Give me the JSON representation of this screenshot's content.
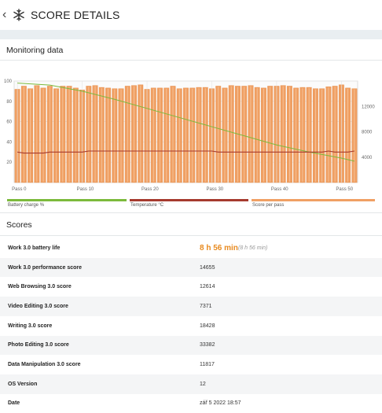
{
  "header": {
    "back_icon": "chevron-left-icon",
    "app_icon": "snowflake-icon",
    "title": "SCORE DETAILS"
  },
  "monitoring": {
    "title": "Monitoring data"
  },
  "chart_data": {
    "type": "bar",
    "x_tick_labels": [
      "Pass 0",
      "Pass 10",
      "Pass 20",
      "Pass 30",
      "Pass 40",
      "Pass 50"
    ],
    "y_left_ticks": [
      "100",
      "80",
      "60",
      "40",
      "20"
    ],
    "y_right_ticks": [
      "12000",
      "8000",
      "4000"
    ],
    "y_left_range": [
      0,
      100
    ],
    "y_right_range": [
      0,
      16000
    ],
    "grid": true,
    "legend_position": "bottom",
    "series": [
      {
        "name": "Battery charge %",
        "color": "#7cba3c",
        "type": "line",
        "axis": "left",
        "x": [
          0,
          5,
          10,
          15,
          20,
          25,
          30,
          35,
          40,
          45,
          50,
          52
        ],
        "values": [
          98,
          96,
          90,
          82,
          73,
          64,
          55,
          46,
          37,
          30,
          24,
          21
        ]
      },
      {
        "name": "Temperature °C",
        "color": "#a63a2e",
        "type": "line",
        "axis": "left",
        "x": [
          0,
          1,
          2,
          3,
          4,
          5,
          6,
          7,
          8,
          9,
          10,
          11,
          12,
          13,
          14,
          15,
          16,
          17,
          18,
          19,
          20,
          21,
          22,
          23,
          24,
          25,
          26,
          27,
          28,
          29,
          30,
          31,
          32,
          33,
          34,
          35,
          36,
          37,
          38,
          39,
          40,
          41,
          42,
          43,
          44,
          45,
          46,
          47,
          48,
          49,
          50,
          51,
          52
        ],
        "values": [
          30,
          29,
          29,
          29,
          29,
          30,
          30,
          30,
          30,
          30,
          30,
          31,
          31,
          31,
          31,
          31,
          31,
          31,
          31,
          31,
          31,
          31,
          31,
          31,
          31,
          31,
          31,
          31,
          31,
          31,
          31,
          30,
          30,
          30,
          30,
          30,
          30,
          30,
          30,
          30,
          30,
          30,
          30,
          30,
          30,
          30,
          30,
          30,
          31,
          30,
          30,
          30,
          31
        ]
      },
      {
        "name": "Score per pass",
        "color": "#f0a064",
        "type": "bar",
        "axis": "right",
        "x": [
          0,
          1,
          2,
          3,
          4,
          5,
          6,
          7,
          8,
          9,
          10,
          11,
          12,
          13,
          14,
          15,
          16,
          17,
          18,
          19,
          20,
          21,
          22,
          23,
          24,
          25,
          26,
          27,
          28,
          29,
          30,
          31,
          32,
          33,
          34,
          35,
          36,
          37,
          38,
          39,
          40,
          41,
          42,
          43,
          44,
          45,
          46,
          47,
          48,
          49,
          50,
          51,
          52
        ],
        "values": [
          14700,
          15200,
          14800,
          15300,
          14900,
          15200,
          14800,
          15200,
          15200,
          14900,
          14600,
          15200,
          15300,
          15000,
          14900,
          14800,
          14800,
          15200,
          15300,
          15400,
          14700,
          14900,
          14900,
          14900,
          15200,
          14800,
          14900,
          14900,
          15000,
          15000,
          14800,
          15200,
          14900,
          15300,
          15200,
          15200,
          15300,
          15000,
          14900,
          15200,
          15200,
          15300,
          15200,
          14900,
          15000,
          15000,
          14800,
          14800,
          15100,
          15200,
          15400,
          14900,
          14800
        ]
      }
    ]
  },
  "scores": {
    "title": "Scores",
    "rows": [
      {
        "label": "Work 3.0 battery life",
        "value": "8 h 56 min",
        "sub": "(8 h 56 min)"
      },
      {
        "label": "Work 3.0 performance score",
        "value": "14655"
      },
      {
        "label": "Web Browsing 3.0 score",
        "value": "12614"
      },
      {
        "label": "Video Editing 3.0 score",
        "value": "7371"
      },
      {
        "label": "Writing 3.0 score",
        "value": "18428"
      },
      {
        "label": "Photo Editing 3.0 score",
        "value": "33382"
      },
      {
        "label": "Data Manipulation 3.0 score",
        "value": "11817"
      },
      {
        "label": "OS Version",
        "value": "12"
      },
      {
        "label": "Date",
        "value": "zář 5 2022 18:57"
      }
    ]
  }
}
